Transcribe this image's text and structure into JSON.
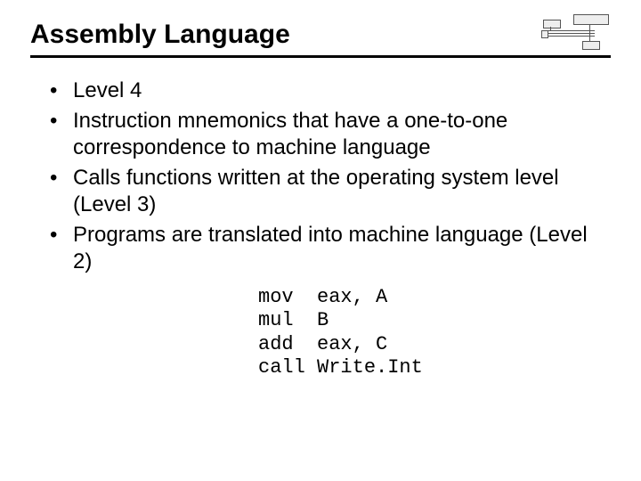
{
  "title": "Assembly Language",
  "bullets": [
    "Level 4",
    "Instruction mnemonics that have a one-to-one correspondence to machine language",
    "Calls functions written at the operating system level (Level 3)",
    "Programs are translated into machine language (Level 2)"
  ],
  "code": "mov  eax, A\nmul  B\nadd  eax, C\ncall Write.Int"
}
